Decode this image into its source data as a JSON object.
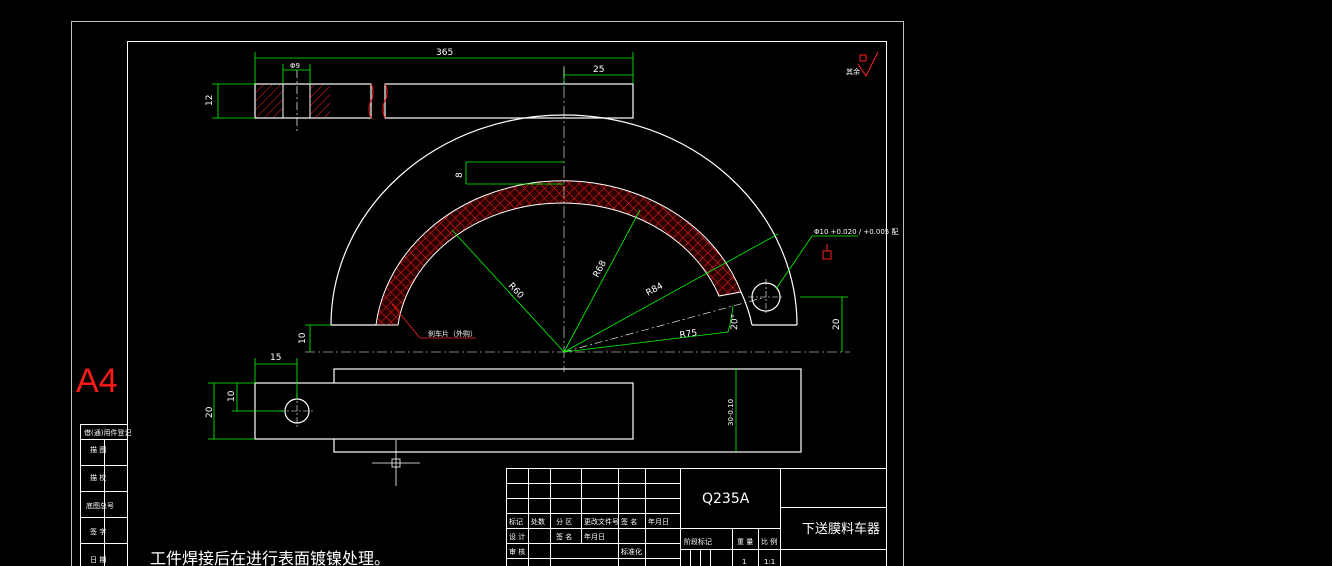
{
  "paper_size": "A4",
  "material": "Q235A",
  "part_name": "下送膜料车器",
  "note": "工件焊接后在进行表面镀镍处理。",
  "surface_finish_label": "其余",
  "friction_label": "刹车片（外购）",
  "tolerance_note": "Φ10 +0.020 / +0.005 配",
  "dimensions": {
    "length": "365",
    "hole_dia": "Φ9",
    "end_len": "25",
    "thick": "12",
    "band": "8",
    "r_inner": "R60",
    "r_mid": "R68",
    "r_outer": "R84",
    "r_hole": "R75",
    "angle": "20°",
    "height_right": "20",
    "height_left": "10",
    "hole_offset": "15",
    "plate_h": "20",
    "plate_hole": "10",
    "plate_w": "30-0.10"
  },
  "left_panel": {
    "rows": [
      "借(通)用件登记",
      "描 图",
      "描 校",
      "底图总号",
      "签 字",
      "日 期"
    ]
  },
  "title_block": {
    "rev_headers": [
      "标记",
      "处数",
      "分 区",
      "更改文件号",
      "签 名",
      "年月日"
    ],
    "row_design": [
      "设 计",
      "签 名",
      "年月日",
      "标准化"
    ],
    "row_check": "审 核",
    "stage_header": [
      "阶段标记",
      "重 量",
      "比 例"
    ],
    "stage_values": [
      "",
      "1",
      "1:1"
    ]
  },
  "colors": {
    "line": "#ffffff",
    "dimension": "#00ff00",
    "hatch": "#ff2020",
    "centerline": "#ffffff",
    "paper_label": "#ff1a1a"
  }
}
